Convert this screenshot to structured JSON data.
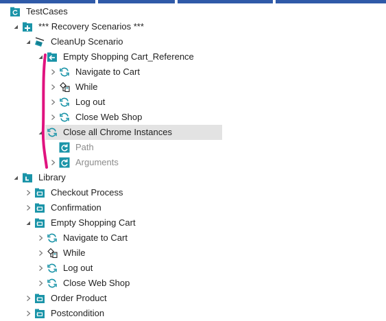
{
  "colors": {
    "accent": "#1a94a8",
    "folder": "#1a94a8",
    "selected_bg": "#e3e3e3",
    "dim_text": "#8c8c8c",
    "annotation": "#e0137f",
    "topbar": "#2f5aa8"
  },
  "tree": [
    {
      "label": "TestCases",
      "icon": "testcase-folder-icon",
      "expander": "expanded"
    },
    {
      "label": "*** Recovery Scenarios ***",
      "icon": "recovery-folder-icon",
      "expander": "expanded"
    },
    {
      "label": "CleanUp Scenario",
      "icon": "broom-icon",
      "expander": "expanded"
    },
    {
      "label": "Empty Shopping Cart_Reference",
      "icon": "reference-icon",
      "expander": "expanded"
    },
    {
      "label": "Navigate to Cart",
      "icon": "refresh-icon",
      "expander": "collapsed"
    },
    {
      "label": "While",
      "icon": "while-icon",
      "expander": "collapsed"
    },
    {
      "label": "Log out",
      "icon": "refresh-icon",
      "expander": "collapsed"
    },
    {
      "label": "Close Web Shop",
      "icon": "refresh-icon",
      "expander": "collapsed"
    },
    {
      "label": "Close all Chrome Instances",
      "icon": "refresh-icon",
      "expander": "expanded",
      "selected": true
    },
    {
      "label": "Path",
      "icon": "refresh-box-icon",
      "expander": "none",
      "dim": true
    },
    {
      "label": "Arguments",
      "icon": "refresh-box-icon",
      "expander": "collapsed",
      "dim": true
    },
    {
      "label": "Library",
      "icon": "library-folder-icon",
      "expander": "expanded"
    },
    {
      "label": "Checkout Process",
      "icon": "module-folder-icon",
      "expander": "collapsed"
    },
    {
      "label": "Confirmation",
      "icon": "module-folder-icon",
      "expander": "collapsed"
    },
    {
      "label": "Empty Shopping Cart",
      "icon": "module-folder-icon",
      "expander": "expanded"
    },
    {
      "label": "Navigate to Cart",
      "icon": "refresh-icon",
      "expander": "collapsed"
    },
    {
      "label": "While",
      "icon": "while-icon",
      "expander": "collapsed"
    },
    {
      "label": "Log out",
      "icon": "refresh-icon",
      "expander": "collapsed"
    },
    {
      "label": "Close Web Shop",
      "icon": "refresh-icon",
      "expander": "collapsed"
    },
    {
      "label": "Order Product",
      "icon": "module-folder-icon",
      "expander": "collapsed"
    },
    {
      "label": "Postcondition",
      "icon": "module-folder-icon",
      "expander": "collapsed"
    }
  ]
}
